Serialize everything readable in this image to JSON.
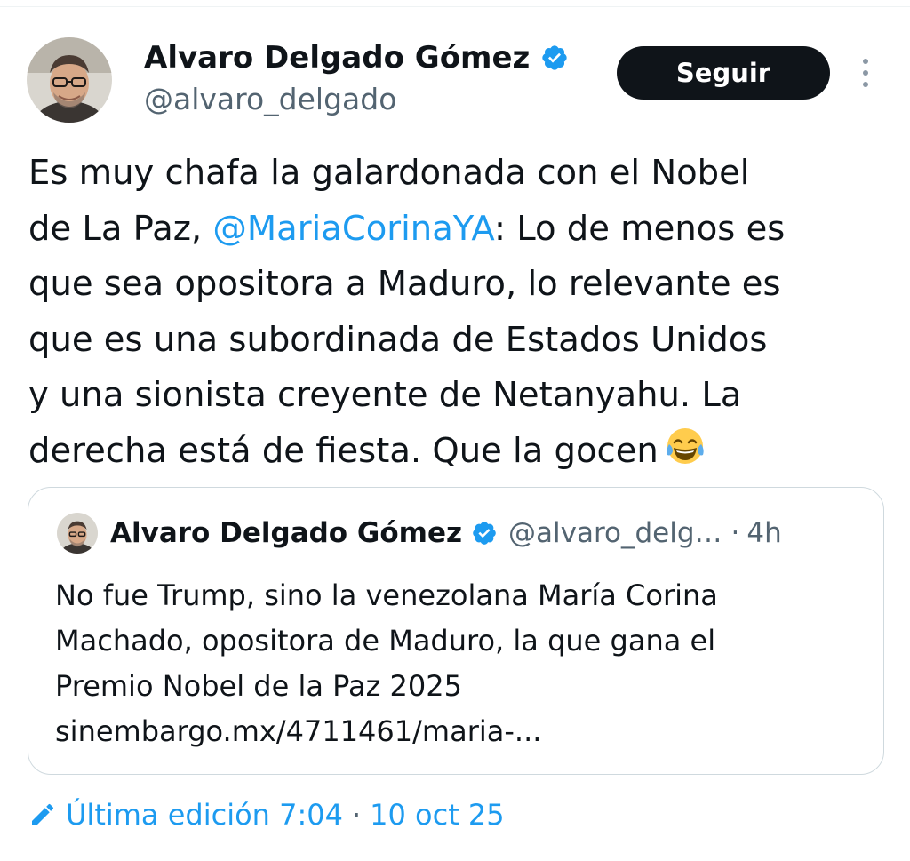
{
  "author": {
    "name": "Alvaro Delgado Gómez",
    "handle": "@alvaro_delgado",
    "avatar_icon": "avatar-photo"
  },
  "actions": {
    "follow_label": "Seguir",
    "more_icon": "more-vertical-icon"
  },
  "tweet": {
    "text_before_mention": "Es muy chafa la galardonada con el Nobel\nde La Paz, ",
    "mention": "@MariaCorinaYA",
    "text_after_mention": ": Lo de menos es\nque sea opositora a Maduro, lo relevante es\nque es una subordinada de Estados Unidos\ny una sionista creyente de Netanyahu. La\nderecha está de fiesta. Que la gocen",
    "emoji": "laughing-tears-emoji"
  },
  "quoted_tweet": {
    "name": "Alvaro Delgado Gómez",
    "handle": "@alvaro_delg…",
    "separator": "·",
    "time": "4h",
    "text": "No fue Trump, sino la venezolana María Corina\nMachado, opositora de Maduro, la que gana el\nPremio Nobel de la Paz 2025\nsinembargo.mx/4711461/maria-..."
  },
  "footer": {
    "edited_label": "Última edición 7:04",
    "separator": "·",
    "date": "10 oct 25"
  },
  "colors": {
    "link": "#1d9bf0",
    "text": "#0f1419",
    "secondary": "#536471",
    "verified": "#1d9bf0",
    "button_bg": "#0f1419"
  }
}
